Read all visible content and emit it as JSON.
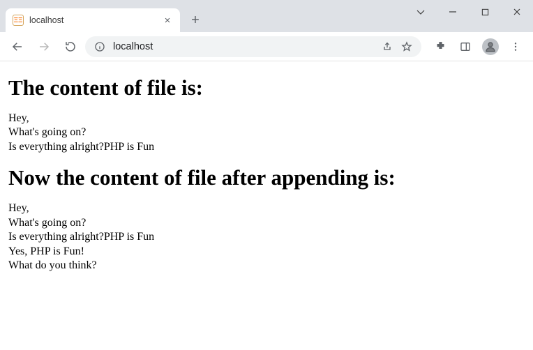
{
  "tab": {
    "title": "localhost"
  },
  "address": {
    "url": "localhost"
  },
  "page": {
    "heading1": "The content of file is:",
    "body1": "Hey,\nWhat's going on?\nIs everything alright?PHP is Fun",
    "heading2": "Now the content of file after appending is:",
    "body2": "Hey,\nWhat's going on?\nIs everything alright?PHP is Fun\nYes, PHP is Fun!\nWhat do you think?"
  }
}
